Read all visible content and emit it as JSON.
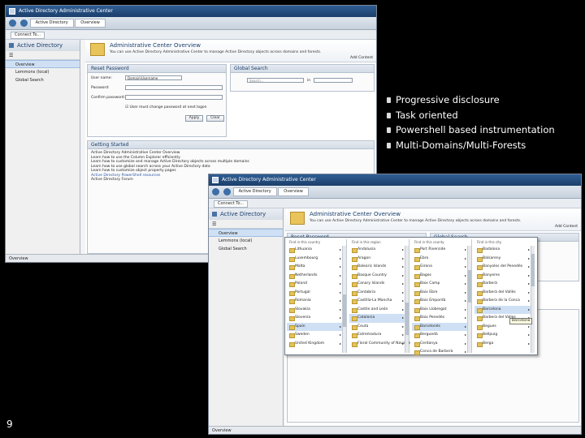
{
  "back_window": {
    "title": "Active Directory Administrative Center",
    "breadcrumb": [
      "Active Directory",
      "Overview"
    ],
    "toolbar_btn": "Connect To...",
    "nav": {
      "header": "Active Directory",
      "items": [
        "Overview",
        "Lemmons (local)",
        "Global Search"
      ]
    },
    "header": {
      "title": "Administrative Center Overview",
      "subtitle": "You can use Active Directory Administrative Center to manage Active Directory objects across domains and forests.",
      "add_content": "Add Content"
    },
    "reset_password": {
      "title": "Reset Password",
      "username_label": "User name:",
      "username_value": "Domain\\Username",
      "password_label": "Password:",
      "confirm_label": "Confirm password:",
      "checkbox_label": "User must change password at next logon",
      "apply": "Apply",
      "clear": "Clear"
    },
    "global_search": {
      "title": "Global Search",
      "search_placeholder": "Search...",
      "in_label": "in"
    },
    "getting_started": {
      "title": "Getting Started",
      "links": [
        "Active Directory Administrative Center Overview",
        "Learn how to use the Column Explorer efficiently",
        "Learn how to customize and manage Active Directory objects across multiple domains",
        "Learn how to use global search across your Active Directory data",
        "Learn how to customize object property pages"
      ],
      "blue_links": [
        "Active Directory PowerShell resources",
        "Active Directory Forum"
      ]
    },
    "status": "Overview"
  },
  "bullets": [
    "Progressive disclosure",
    "Task oriented",
    "Powershell based instrumentation",
    "Multi-Domains/Multi-Forests"
  ],
  "page_number": "9",
  "front_window": {
    "title": "Active Directory Administrative Center",
    "breadcrumb": [
      "Active Directory",
      "Overview"
    ],
    "toolbar_btn": "Connect To...",
    "nav": {
      "header": "Active Directory",
      "items": [
        "Overview",
        "Lemmons (local)",
        "Global Search"
      ]
    },
    "header": {
      "title": "Administrative Center Overview",
      "subtitle": "You can use Active Directory Administrative Center to manage Active Directory objects across domains and forests.",
      "add_content": "Add Content"
    },
    "panel_titles": [
      "Reset Password",
      "Global Search"
    ],
    "status": "Overview",
    "cascade": {
      "columns": [
        {
          "head": "Find in this country",
          "items": [
            "Lithuania",
            "Luxembourg",
            "Malta",
            "Netherlands",
            "Poland",
            "Portugal",
            "Romania",
            "Slovakia",
            "Slovenia",
            "Spain",
            "Sweden",
            "United Kingdom"
          ],
          "selected": 9
        },
        {
          "head": "Find in this region",
          "items": [
            "Andalusia",
            "Aragon",
            "Balearic Islands",
            "Basque Country",
            "Canary Islands",
            "Cantabria",
            "Castilla-La Mancha",
            "Castile and León",
            "Catalonia",
            "Ceuta",
            "Extremadura",
            "Floral Community of Navarre"
          ],
          "selected": 8
        },
        {
          "head": "Find in this county",
          "items": [
            "Port Riverside",
            "Ebro",
            "Girona",
            "Bages",
            "Baix Camp",
            "Baix Ebre",
            "Baix Empordà",
            "Baix Llobregat",
            "Baix Penedès",
            "Barcelonès",
            "Berguedà",
            "Cerdanya",
            "Conca de Barberà"
          ],
          "selected": 9
        },
        {
          "head": "Find in this city",
          "items": [
            "Badalona",
            "Balsareny",
            "Banyoles del Penedès",
            "Banyeres",
            "Barberà",
            "Barberà del Vallès",
            "Barbera de la Conca",
            "Barcelona",
            "Barbera del Valles",
            "Begues",
            "Bellpuig",
            "Berga"
          ],
          "selected": 7
        }
      ],
      "tooltip": "Barcelona"
    }
  }
}
